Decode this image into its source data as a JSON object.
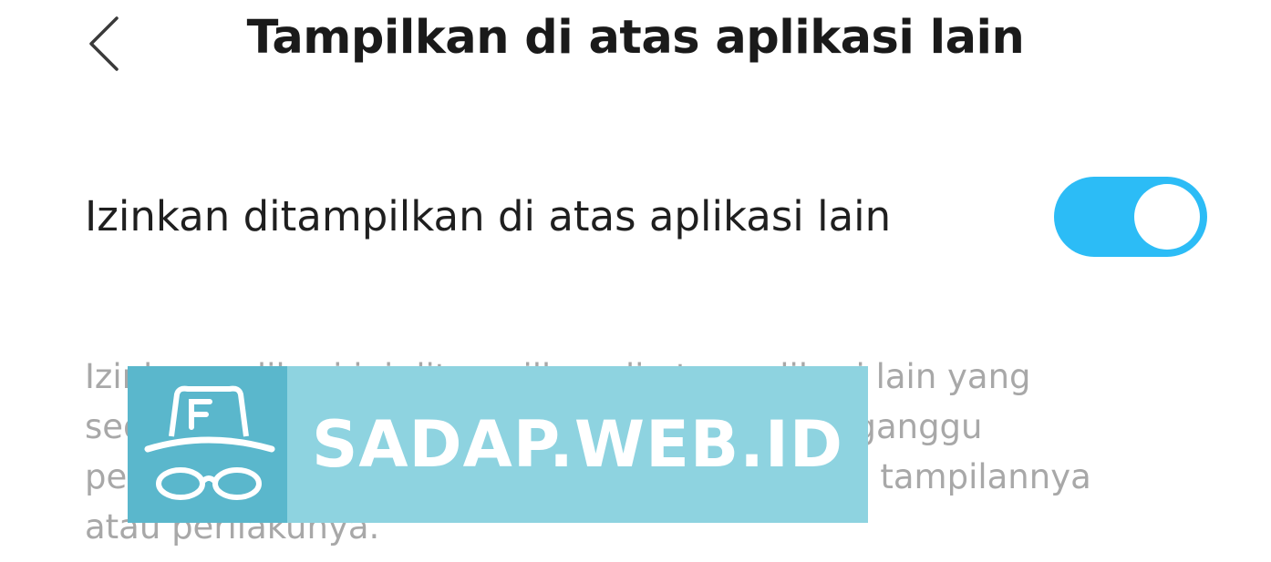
{
  "header": {
    "title": "Tampilkan di atas aplikasi lain",
    "back_icon": "chevron-left-icon"
  },
  "setting": {
    "label": "Izinkan ditampilkan di atas aplikasi lain",
    "toggle_state": "on",
    "toggle_color": "#2cbcf6"
  },
  "description": {
    "text": "Izinkan aplikasi ini ditampilkan di atas aplikasi lain yang sedang Anda gunakan. Hal ini mungkin mengganggu penggunaan aplikasi lain atau mengubah cara tampilannya atau perilakunya."
  },
  "watermark": {
    "text": "SADAP.WEB.ID",
    "logo_icon": "incognito-hat-glasses-icon",
    "color_bg": "#8ed3e0",
    "color_logo_bg": "#5ab7cc"
  }
}
